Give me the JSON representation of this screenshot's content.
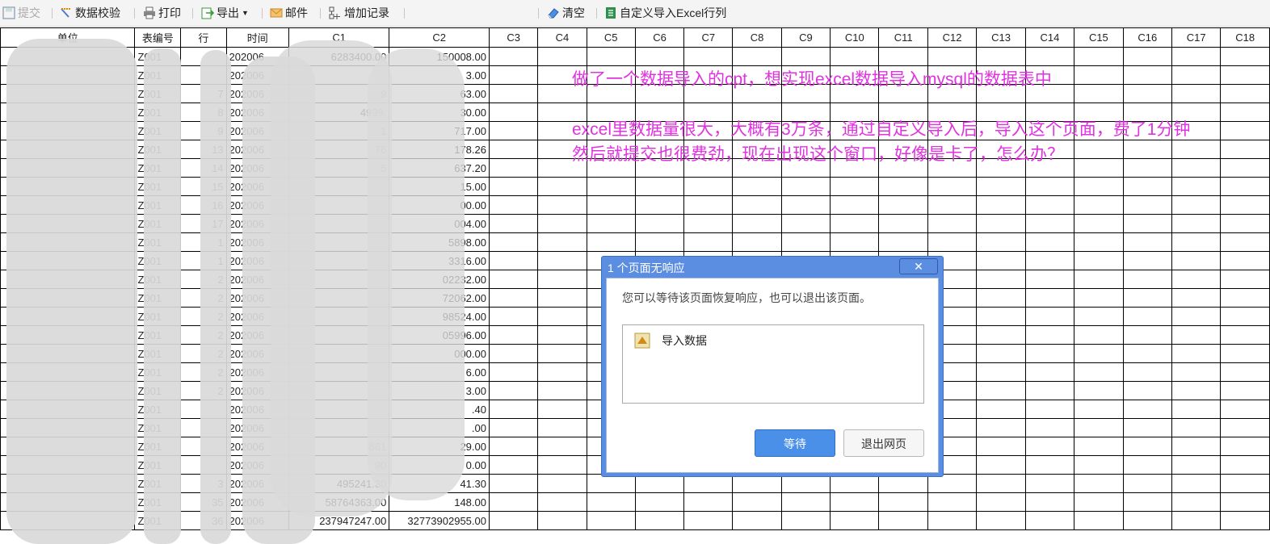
{
  "toolbar": {
    "submit": "提交",
    "validate": "数据校验",
    "print": "打印",
    "export": "导出",
    "mail": "邮件",
    "add_record": "增加记录",
    "clear": "清空",
    "custom_import": "自定义导入Excel行列"
  },
  "grid": {
    "headers": [
      "单位",
      "表编号",
      "行",
      "时间",
      "C1",
      "C2",
      "C3",
      "C4",
      "C5",
      "C6",
      "C7",
      "C8",
      "C9",
      "C10",
      "C11",
      "C12",
      "C13",
      "C14",
      "C15",
      "C16",
      "C17",
      "C18"
    ],
    "rows": [
      {
        "c0": "",
        "c1": "Z001",
        "c2": "",
        "c3": "202006",
        "c4": "6283400.00",
        "c5": "150008.00"
      },
      {
        "c0": "",
        "c1": "Z001",
        "c2": "",
        "c3": "202006",
        "c4": "",
        "c5": "3.00"
      },
      {
        "c0": "",
        "c1": "Z001",
        "c2": "7",
        "c3": "202006",
        "c4": "9",
        "c5": "63.00"
      },
      {
        "c0": "",
        "c1": "Z001",
        "c2": "8",
        "c3": "202006",
        "c4": "4939.",
        "c5": "30.00"
      },
      {
        "c0": "",
        "c1": "Z001",
        "c2": "9",
        "c3": "202006",
        "c4": "1",
        "c5": "717.00"
      },
      {
        "c0": "",
        "c1": "Z001",
        "c2": "13",
        "c3": "202006",
        "c4": "76",
        "c5": "178.26"
      },
      {
        "c0": "",
        "c1": "Z001",
        "c2": "14",
        "c3": "202006",
        "c4": "5",
        "c5": "637.20"
      },
      {
        "c0": "",
        "c1": "Z001",
        "c2": "15",
        "c3": "202006",
        "c4": "",
        "c5": "15.00"
      },
      {
        "c0": "",
        "c1": "Z001",
        "c2": "16",
        "c3": "202006",
        "c4": "",
        "c5": "00.00"
      },
      {
        "c0": "",
        "c1": "Z001",
        "c2": "17",
        "c3": "202006",
        "c4": "",
        "c5": "004.00"
      },
      {
        "c0": "",
        "c1": "Z001",
        "c2": "1",
        "c3": "202006",
        "c4": "",
        "c5": "5898.00"
      },
      {
        "c0": "",
        "c1": "Z001",
        "c2": "1",
        "c3": "202006",
        "c4": "",
        "c5": "3316.00"
      },
      {
        "c0": "",
        "c1": "Z001",
        "c2": "2",
        "c3": "202006",
        "c4": "",
        "c5": "02232.00"
      },
      {
        "c0": "",
        "c1": "Z001",
        "c2": "2",
        "c3": "202006",
        "c4": "",
        "c5": "72062.00"
      },
      {
        "c0": "",
        "c1": "Z001",
        "c2": "2",
        "c3": "202006",
        "c4": "",
        "c5": "98524.00"
      },
      {
        "c0": "",
        "c1": "Z001",
        "c2": "2",
        "c3": "202006",
        "c4": "",
        "c5": "05996.00"
      },
      {
        "c0": "",
        "c1": "Z001",
        "c2": "2",
        "c3": "202006",
        "c4": "",
        "c5": "000.00"
      },
      {
        "c0": "",
        "c1": "Z001",
        "c2": "2",
        "c3": "202006",
        "c4": "",
        "c5": "6.00"
      },
      {
        "c0": "",
        "c1": "Z001",
        "c2": "2",
        "c3": "202006",
        "c4": "",
        "c5": "3.00"
      },
      {
        "c0": "",
        "c1": "Z001",
        "c2": "",
        "c3": "202006",
        "c4": "",
        "c5": ".40"
      },
      {
        "c0": "",
        "c1": "Z001",
        "c2": "",
        "c3": "202006",
        "c4": "",
        "c5": ".00"
      },
      {
        "c0": "",
        "c1": "Z001",
        "c2": "",
        "c3": "202006",
        "c4": "861",
        "c5": "29.00"
      },
      {
        "c0": "",
        "c1": "Z001",
        "c2": "",
        "c3": "202006",
        "c4": "90",
        "c5": "0.00"
      },
      {
        "c0": "",
        "c1": "Z001",
        "c2": "3",
        "c3": "202006",
        "c4": "495241.30",
        "c5": "41.30"
      },
      {
        "c0": "",
        "c1": "Z001",
        "c2": "35",
        "c3": "202006",
        "c4": "58764363.00",
        "c5": "148.00"
      },
      {
        "c0": "",
        "c1": "Z001",
        "c2": "36",
        "c3": "202006",
        "c4": "237947247.00",
        "c5": "32773902955.00"
      }
    ]
  },
  "annotation": {
    "line1": "做了一个数据导入的cpt，想实现excel数据导入mysql的数据表中",
    "line2": "excel里数据量很大，大概有3万条，通过自定义导入后，导入这个页面，费了1分钟",
    "line3": "然后就提交也很费劲，现在出现这个窗口，好像是卡了，怎么办？"
  },
  "dialog": {
    "title": "1 个页面无响应",
    "close": "✕",
    "message": "您可以等待该页面恢复响应，也可以退出该页面。",
    "item": "导入数据",
    "wait_button": "等待",
    "exit_button": "退出网页"
  }
}
